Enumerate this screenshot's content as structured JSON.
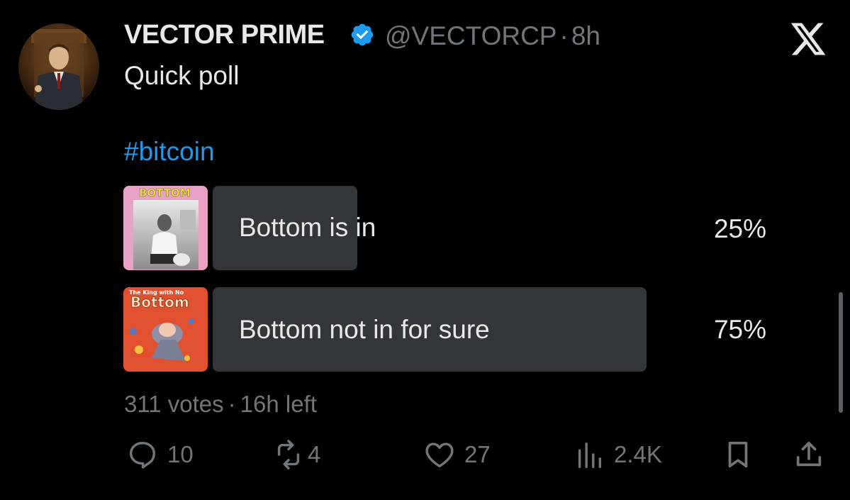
{
  "author": {
    "name": "VECTOR PRIME",
    "handle": "@VECTORCP",
    "separator": "·",
    "time": "8h",
    "verified": true,
    "avatar": "man-in-suit-on-throne-avatar"
  },
  "tweet": {
    "line1": "Quick poll",
    "hashtag": "#bitcoin"
  },
  "poll": {
    "options": [
      {
        "label": "Bottom is in",
        "percent": "25%",
        "share": 0.25,
        "thumbnail": "bottom-meme-image",
        "thumb_text": "BOTTOM"
      },
      {
        "label": "Bottom not in for sure",
        "percent": "75%",
        "share": 0.75,
        "thumbnail": "bottom-book-cover-image",
        "thumb_text": "Bottom",
        "thumb_top_text": "The King with No"
      }
    ],
    "votes": "311 votes",
    "separator": "·",
    "time_left": "16h left"
  },
  "actions": {
    "replies": "10",
    "reposts": "4",
    "likes": "27",
    "views": "2.4K"
  },
  "colors": {
    "background": "#000000",
    "text": "#e7e9ea",
    "muted": "#71767b",
    "link": "#1d9bf0",
    "poll_bar": "#333639"
  }
}
